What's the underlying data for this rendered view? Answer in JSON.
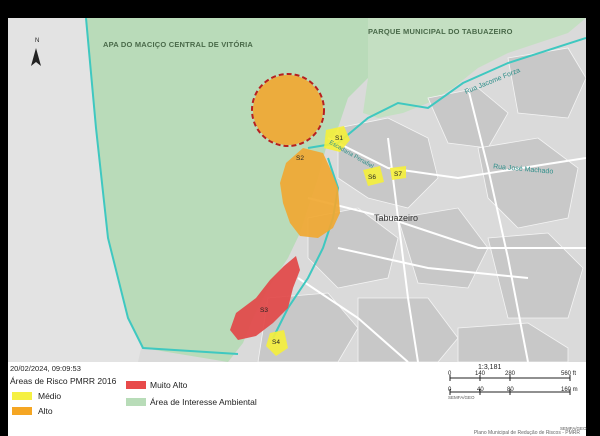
{
  "map": {
    "labels": {
      "apa": "APA DO MACIÇO CENTRAL DE VITÓRIA",
      "parque": "PARQUE MUNICIPAL DO TABUAZEIRO",
      "rua_jacome": "Rua Jacome Forza",
      "rua_jose": "Rua José Machado",
      "rua_escadaria": "Escadaria Penafiel",
      "bairro": "Tabuazeiro"
    },
    "areas": [
      "S1",
      "S2",
      "S3",
      "S4",
      "S6",
      "S7"
    ],
    "north_label": "N"
  },
  "legend": {
    "timestamp": "20/02/2024, 09:09:53",
    "title": "Áreas de Risco PMRR 2016",
    "items": [
      {
        "label": "Médio",
        "color": "#f5f043"
      },
      {
        "label": "Alto",
        "color": "#f5a623"
      },
      {
        "label": "Muito Alto",
        "color": "#e84a4a"
      },
      {
        "label": "Área de Interesse Ambiental",
        "color": "#b8dcb8"
      }
    ],
    "scale_ratio": "1:3,181",
    "scale_ft": [
      "0",
      "140",
      "280",
      "560 ft"
    ],
    "scale_m": [
      "0",
      "40",
      "80",
      "160 m"
    ],
    "source_left": "SEMFA/GEO",
    "source_right": "SEMFA/GEO",
    "credit": "Plano Municipal de Redução de Riscos - PMRR"
  }
}
